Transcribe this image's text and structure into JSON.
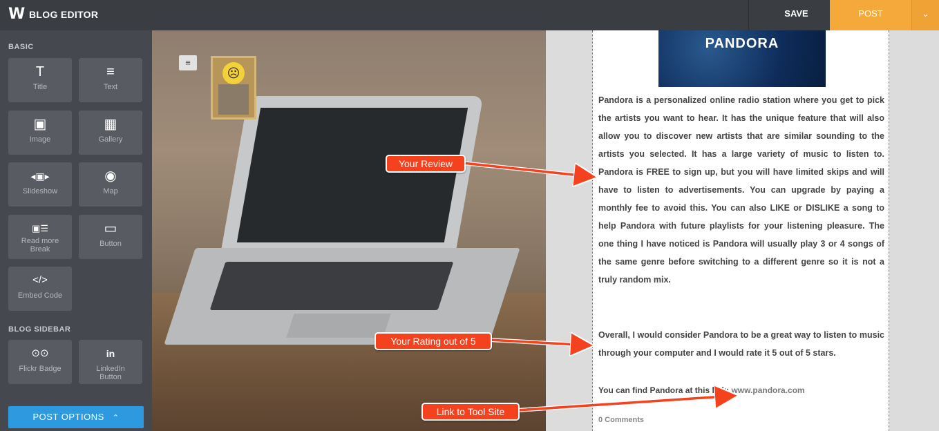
{
  "header": {
    "logo_glyph": "W",
    "app_title": "BLOG EDITOR",
    "save_label": "SAVE",
    "post_label": "POST",
    "post_caret": "⌄"
  },
  "sidebar": {
    "basic_label": "BASIC",
    "basic_items": [
      {
        "label": "Title",
        "icon": "T"
      },
      {
        "label": "Text",
        "icon": "≡"
      },
      {
        "label": "Image",
        "icon": "▣"
      },
      {
        "label": "Gallery",
        "icon": "▦"
      },
      {
        "label": "Slideshow",
        "icon": "◂▣▸"
      },
      {
        "label": "Map",
        "icon": "◉"
      },
      {
        "label": "Read more\nBreak",
        "icon": "▣☰"
      },
      {
        "label": "Button",
        "icon": "▭"
      },
      {
        "label": "Embed Code",
        "icon": "</>"
      }
    ],
    "blog_sidebar_label": "BLOG SIDEBAR",
    "blog_sidebar_items": [
      {
        "label": "Flickr Badge",
        "icon": "⊙⊙"
      },
      {
        "label": "LinkedIn\nButton",
        "icon": "in"
      }
    ],
    "post_options_label": "POST OPTIONS",
    "post_options_caret": "⌃"
  },
  "hero": {
    "menu_icon": "≡",
    "avatar_face": "☹"
  },
  "blog": {
    "banner_text": "PANDORA",
    "review": "Pandora is a personalized online radio station where you get to pick the artists you want to hear.  It has the unique feature that will also allow you to discover new artists that are similar sounding to the artists you selected. It has a large variety of music to listen to.  Pandora is FREE to sign up, but you will have limited skips and will have to listen to advertisements.  You can upgrade by paying a monthly fee to avoid this.  You can also LIKE or DISLIKE a song to help Pandora with future playlists for your listening pleasure.  The one thing I have noticed is Pandora will usually play 3 or 4 songs of the same genre before switching to a different genre so it is not a truly random mix.",
    "rating": "Overall, I would consider Pandora to be a great way to listen to music through your computer and I would rate it 5 out of 5 stars.",
    "link_prefix": "You can find Pandora at this link: ",
    "link_text": "www.pandora.com",
    "comments": "0 Comments"
  },
  "callouts": {
    "review": "Your Review",
    "rating": "Your Rating out of 5",
    "link": "Link to Tool Site"
  },
  "colors": {
    "post_button": "#f5a93a",
    "post_options": "#2d9ae0",
    "callout": "#f4411e"
  }
}
